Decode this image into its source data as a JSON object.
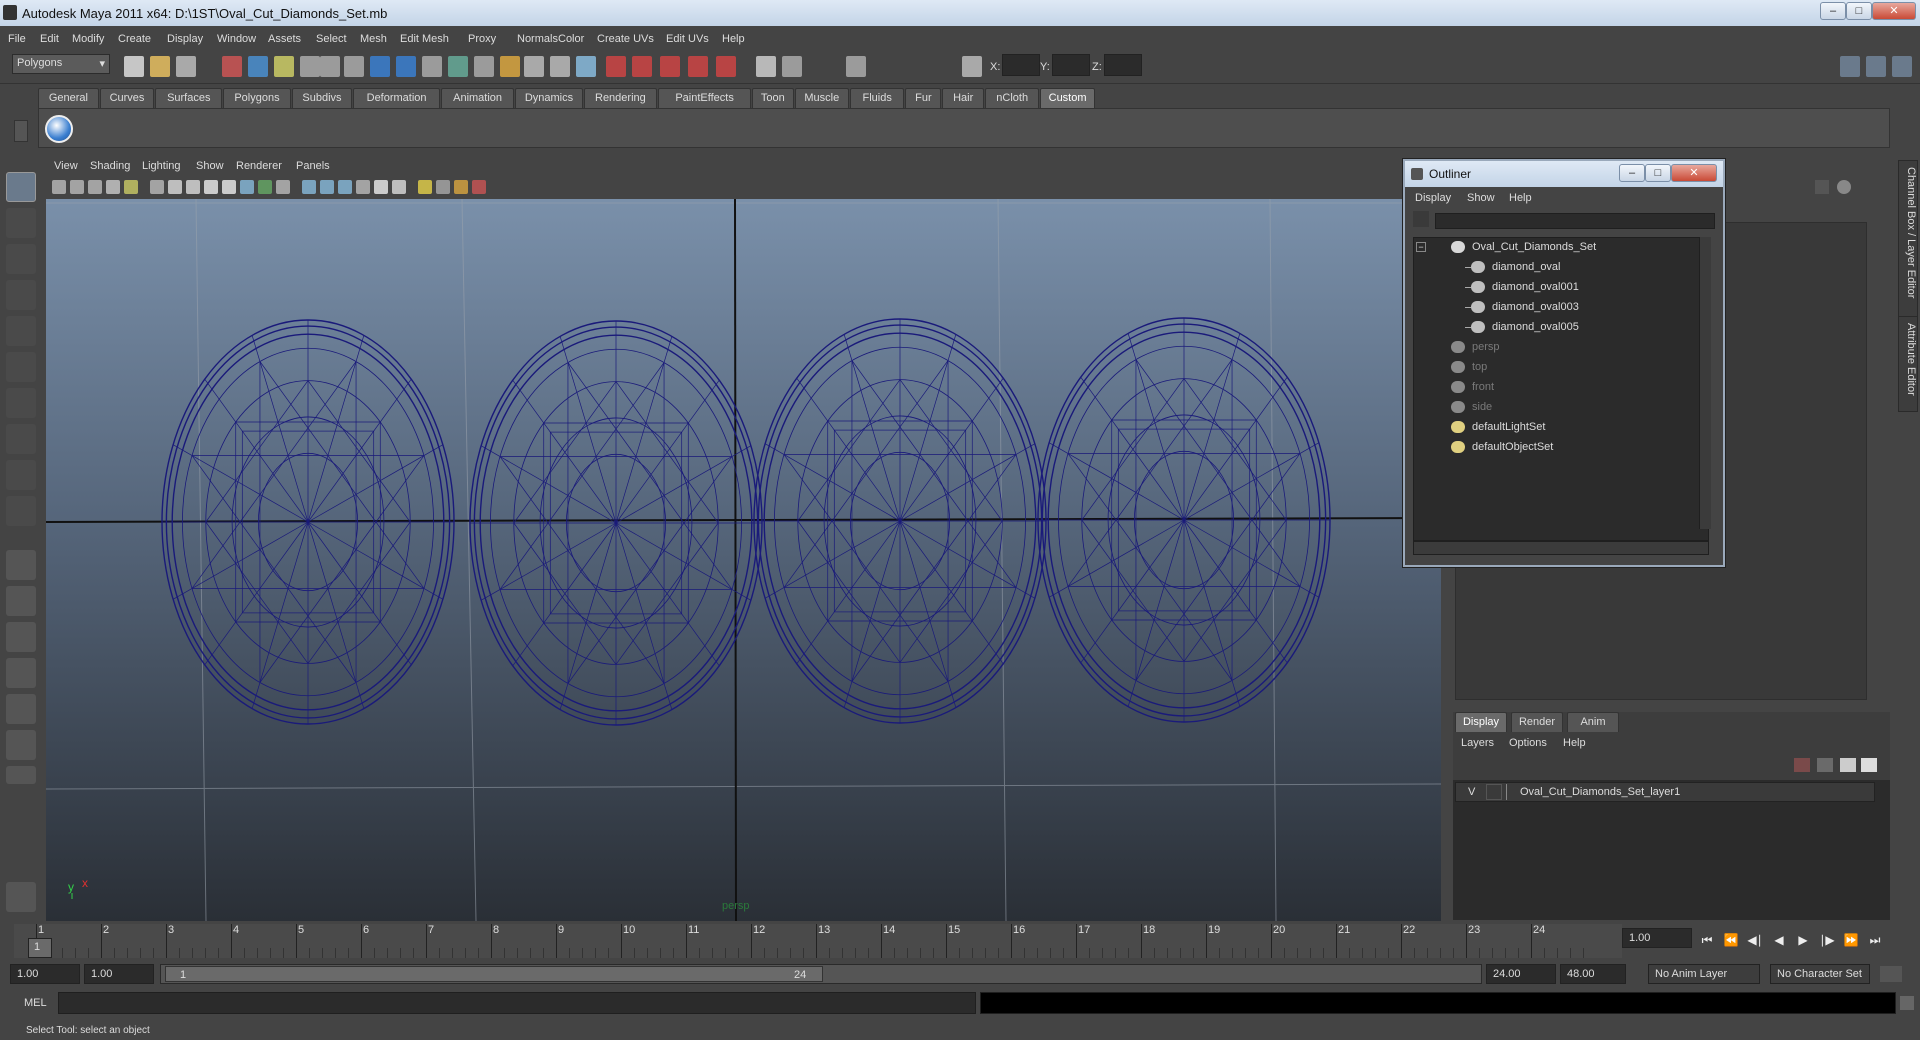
{
  "window": {
    "title": "Autodesk Maya 2011 x64: D:\\1ST\\Oval_Cut_Diamonds_Set.mb"
  },
  "menus": [
    "File",
    "Edit",
    "Modify",
    "Create",
    "Display",
    "Window",
    "Assets",
    "Select",
    "Mesh",
    "Edit Mesh",
    "Proxy",
    "Normals",
    "Color",
    "Create UVs",
    "Edit UVs",
    "Help"
  ],
  "status_line": {
    "mode_selector": "Polygons",
    "coord_labels": [
      "X:",
      "Y:",
      "Z:"
    ]
  },
  "shelf_tabs": [
    "General",
    "Curves",
    "Surfaces",
    "Polygons",
    "Subdivs",
    "Deformation",
    "Animation",
    "Dynamics",
    "Rendering",
    "PaintEffects",
    "Toon",
    "Muscle",
    "Fluids",
    "Fur",
    "Hair",
    "nCloth",
    "Custom"
  ],
  "shelf_active_tab": "Custom",
  "viewport": {
    "menus": [
      "View",
      "Shading",
      "Lighting",
      "Show",
      "Renderer",
      "Panels"
    ],
    "camera_label": "persp",
    "axis_y": "y",
    "axis_x": "x",
    "wireframe_color": "#1a1a7a"
  },
  "outliner": {
    "title": "Outliner",
    "menus": [
      "Display",
      "Show",
      "Help"
    ],
    "items": [
      {
        "label": "Oval_Cut_Diamonds_Set",
        "level": 0,
        "type": "group",
        "dim": false
      },
      {
        "label": "diamond_oval",
        "level": 1,
        "type": "mesh",
        "dim": false
      },
      {
        "label": "diamond_oval001",
        "level": 1,
        "type": "mesh",
        "dim": false
      },
      {
        "label": "diamond_oval003",
        "level": 1,
        "type": "mesh",
        "dim": false
      },
      {
        "label": "diamond_oval005",
        "level": 1,
        "type": "mesh",
        "dim": false
      },
      {
        "label": "persp",
        "level": 0,
        "type": "camera",
        "dim": true
      },
      {
        "label": "top",
        "level": 0,
        "type": "camera",
        "dim": true
      },
      {
        "label": "front",
        "level": 0,
        "type": "camera",
        "dim": true
      },
      {
        "label": "side",
        "level": 0,
        "type": "camera",
        "dim": true
      },
      {
        "label": "defaultLightSet",
        "level": 0,
        "type": "set",
        "dim": false
      },
      {
        "label": "defaultObjectSet",
        "level": 0,
        "type": "set",
        "dim": false
      }
    ]
  },
  "side_tabs": {
    "channel_box": "Channel Box / Layer Editor",
    "attribute_editor": "Attribute Editor"
  },
  "layer_editor": {
    "tabs": [
      "Display",
      "Render",
      "Anim"
    ],
    "active_tab": "Display",
    "menus": [
      "Layers",
      "Options",
      "Help"
    ],
    "layers": [
      {
        "visible": "V",
        "name": "Oval_Cut_Diamonds_Set_layer1"
      }
    ]
  },
  "time_slider": {
    "ticks": [
      "1",
      "2",
      "3",
      "4",
      "5",
      "6",
      "7",
      "8",
      "9",
      "10",
      "11",
      "12",
      "13",
      "14",
      "15",
      "16",
      "17",
      "18",
      "19",
      "20",
      "21",
      "22",
      "23",
      "24"
    ],
    "current_frame": "1",
    "current_time_field": "1.00"
  },
  "range_slider": {
    "start_time": "1.00",
    "playback_start": "1.00",
    "range_start": "1",
    "range_end": "24",
    "playback_end": "24.00",
    "end_time": "48.00",
    "anim_layer": "No Anim Layer",
    "character_set": "No Character Set"
  },
  "command_line": {
    "label": "MEL"
  },
  "help_line": {
    "text": "Select Tool: select an object"
  }
}
